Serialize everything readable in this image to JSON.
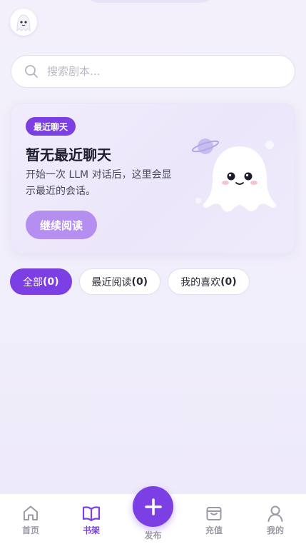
{
  "search": {
    "placeholder": "搜索剧本..."
  },
  "card": {
    "badge": "最近聊天",
    "title": "暂无最近聊天",
    "description": "开始一次 LLM 对话后，这里会显示最近的会话。",
    "button_label": "继续阅读"
  },
  "filters": [
    {
      "label": "全部",
      "count": "(0)",
      "active": true
    },
    {
      "label": "最近阅读",
      "count": "(0)",
      "active": false
    },
    {
      "label": "我的喜欢",
      "count": "(0)",
      "active": false
    }
  ],
  "tabbar": {
    "home": "首页",
    "bookshelf": "书架",
    "publish": "发布",
    "recharge": "充值",
    "mine": "我的",
    "active": "bookshelf"
  },
  "colors": {
    "accent": "#7b3fe4",
    "accent_light": "#b48ff0"
  },
  "icons": [
    "avatar-ghost-icon",
    "search-icon",
    "ghost-mascot-icon",
    "planet-icon",
    "home-icon",
    "book-icon",
    "plus-icon",
    "wallet-icon",
    "user-icon"
  ]
}
